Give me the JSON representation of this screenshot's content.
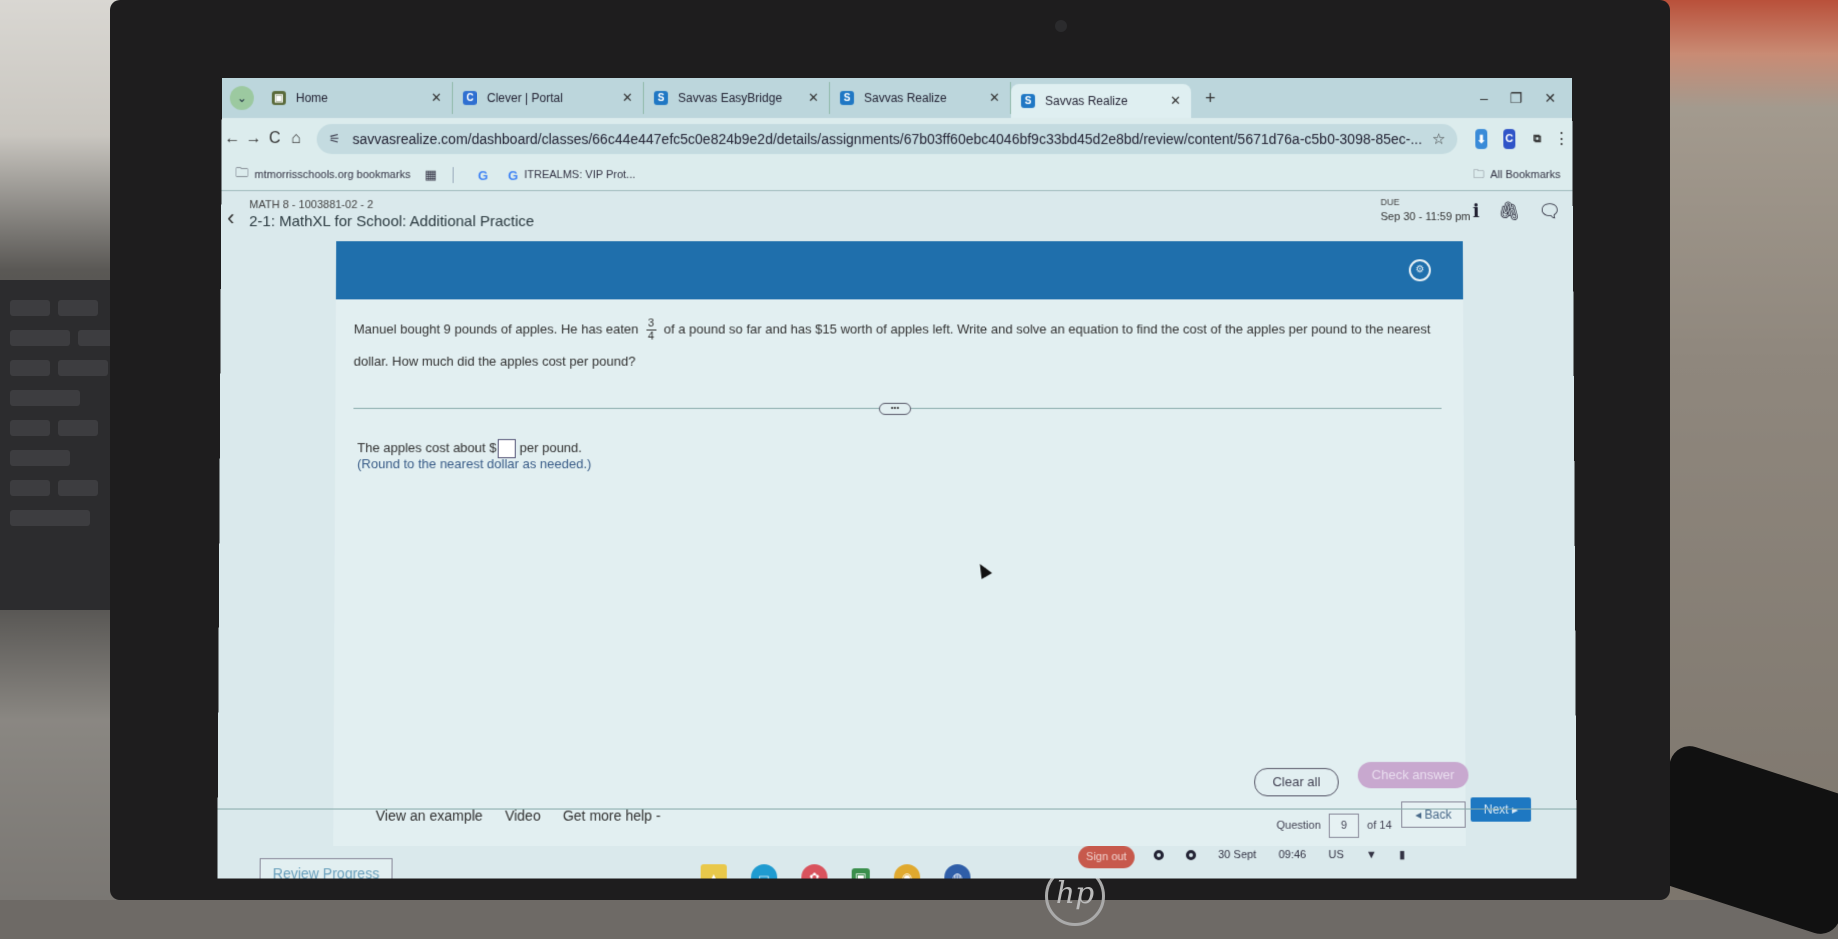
{
  "browser": {
    "tabs": [
      {
        "title": "Home",
        "favicon": "classroom-icon",
        "color": "#5a6a3a",
        "glyph": "▣"
      },
      {
        "title": "Clever | Portal",
        "favicon": "clever-icon",
        "color": "#2f6fd1",
        "glyph": "C"
      },
      {
        "title": "Savvas EasyBridge",
        "favicon": "savvas-icon",
        "color": "#1f77c4",
        "glyph": "S"
      },
      {
        "title": "Savvas Realize",
        "favicon": "savvas-icon",
        "color": "#1f77c4",
        "glyph": "S"
      },
      {
        "title": "Savvas Realize",
        "favicon": "savvas-icon",
        "color": "#1f77c4",
        "glyph": "S",
        "active": true
      }
    ],
    "new_tab": "+",
    "window_controls": [
      "–",
      "❐",
      "✕"
    ],
    "nav": {
      "back": "←",
      "forward": "→",
      "reload": "C",
      "home": "⌂"
    },
    "url": "savvasrealize.com/dashboard/classes/66c44e447efc5c0e824b9e2d/details/assignments/67b03ff60ebc4046bf9c33bd45d2e8bd/review/content/5671d76a-c5b0-3098-85ec-...",
    "star": "☆",
    "extensions": [
      {
        "name": "extension-bookmark-icon",
        "color": "#3a8bd8",
        "glyph": "⬇"
      },
      {
        "name": "extension-clever-icon",
        "color": "#2f54c8",
        "glyph": "C"
      },
      {
        "name": "extensions-puzzle-icon",
        "color": "#dceced",
        "glyph": "⧉"
      }
    ],
    "menu": "⋮",
    "bookmarks": {
      "items": [
        {
          "label": "mtmorrisschools.org bookmarks",
          "icon": "🗀"
        },
        {
          "label": "",
          "icon": "▦"
        },
        {
          "label": "",
          "icon": "G"
        },
        {
          "label": "ITREALMS: VIP Prot...",
          "icon": "G"
        }
      ],
      "all_bookmarks": "All Bookmarks"
    }
  },
  "assignment": {
    "course": "MATH 8 - 1003881-02 - 2",
    "title": "2-1: MathXL for School: Additional Practice",
    "due_label": "DUE",
    "due_date": "Sep 30 - 11:59 pm",
    "header_icons": {
      "info": "i",
      "attachment": "🖇",
      "comment": "🗨"
    }
  },
  "question": {
    "text_before": "Manuel bought 9 pounds of apples. He has eaten",
    "fraction": {
      "numerator": "3",
      "denominator": "4"
    },
    "text_after": "of a pound so far and has $15 worth of apples left. Write and solve an equation to find the cost of the apples per pound to the nearest dollar. How much did the apples cost per pound?",
    "answer_prefix": "The apples cost about $",
    "answer_value": "",
    "answer_suffix": "per pound.",
    "hint": "(Round to the nearest dollar as needed.)",
    "expand": "•••"
  },
  "controls": {
    "clear_all": "Clear all",
    "check_answer": "Check answer",
    "help_links": [
      "View an example",
      "Video",
      "Get more help -"
    ],
    "question_label": "Question",
    "question_number": "9",
    "question_total": "of 14",
    "back": "◂ Back",
    "next": "Next ▸",
    "review_progress": "Review Progress"
  },
  "shelf": {
    "apps": [
      {
        "name": "google-drive-icon",
        "color": "#e9c84a",
        "glyph": "▲"
      },
      {
        "name": "screencast-icon",
        "color": "#1f9bd0",
        "glyph": "▭"
      },
      {
        "name": "app-red-icon",
        "color": "#d9535d",
        "glyph": "✿"
      },
      {
        "name": "google-classroom-icon",
        "color": "#3b8f4c",
        "glyph": "▣"
      },
      {
        "name": "chrome-icon",
        "color": "#e0a92e",
        "glyph": "◉"
      },
      {
        "name": "meet-icon",
        "color": "#2f5ea8",
        "glyph": "◍"
      }
    ],
    "sign_out": "Sign out",
    "date": "30 Sept",
    "time": "09:46",
    "locale": "US",
    "wifi": "▼",
    "battery": "▮"
  }
}
